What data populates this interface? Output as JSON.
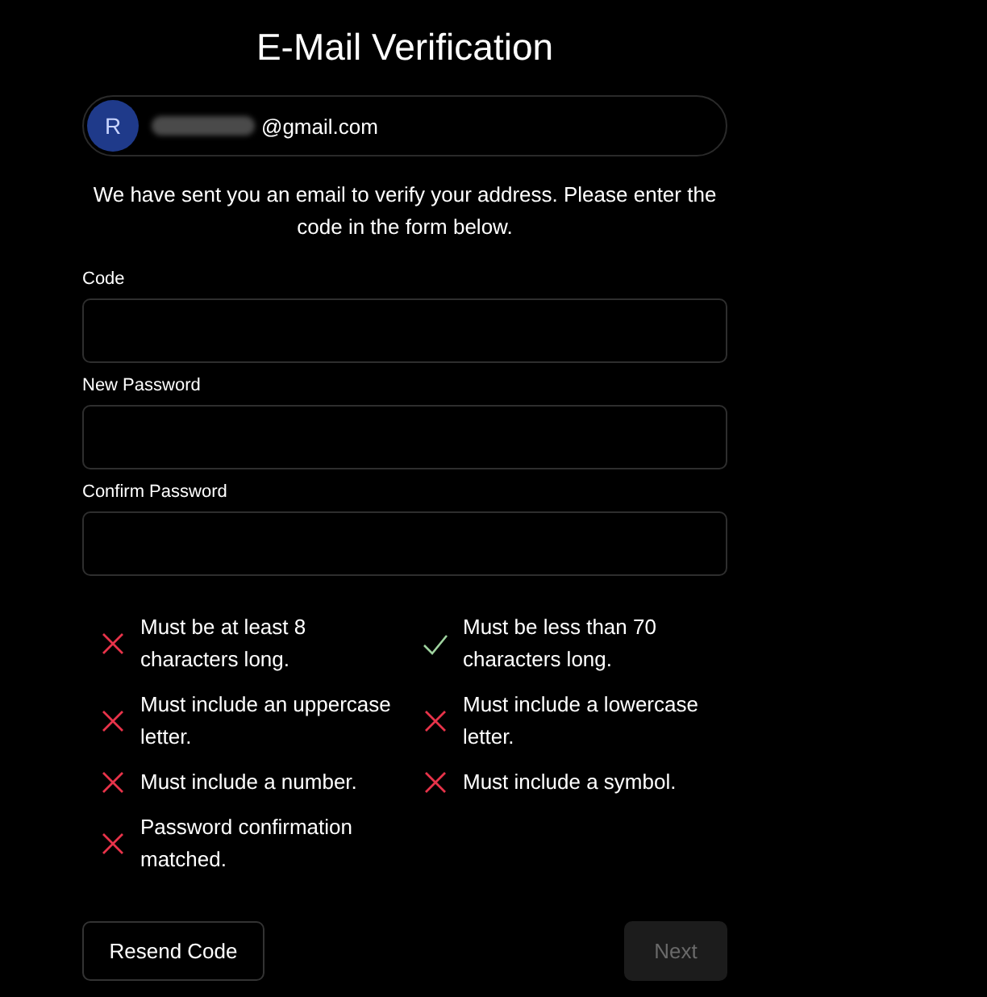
{
  "title": "E-Mail Verification",
  "account": {
    "initial": "R",
    "email": "@gmail.com",
    "redacted": true
  },
  "message": "We have sent you an email to verify your address. Please enter the code in the form below.",
  "fields": [
    {
      "label": "Code"
    },
    {
      "label": "New Password"
    },
    {
      "label": "Confirm Password"
    }
  ],
  "requirements": [
    {
      "text": "Must be at least 8 characters long.",
      "met": false
    },
    {
      "text": "Must be less than 70 characters long.",
      "met": true
    },
    {
      "text": "Must include an uppercase letter.",
      "met": false
    },
    {
      "text": "Must include a lowercase letter.",
      "met": false
    },
    {
      "text": "Must include a number.",
      "met": false
    },
    {
      "text": "Must include a symbol.",
      "met": false
    },
    {
      "text": "Password confirmation matched.",
      "met": false
    }
  ],
  "buttons": [
    {
      "label": "Resend Code",
      "kind": "outline",
      "disabled": false
    },
    {
      "label": "Next",
      "kind": "primary",
      "disabled": true
    }
  ]
}
